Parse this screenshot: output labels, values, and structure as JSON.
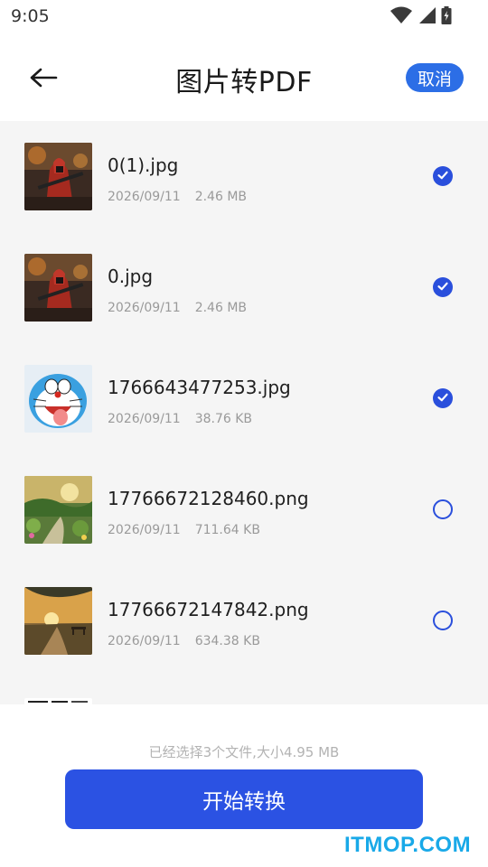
{
  "status_bar": {
    "time": "9:05",
    "icons": [
      "wifi-icon",
      "signal-icon",
      "battery-icon"
    ]
  },
  "header": {
    "title": "图片转PDF",
    "cancel_label": "取消",
    "back_icon": "arrow-left-icon"
  },
  "files": [
    {
      "name": "0(1).jpg",
      "date": "2026/09/11",
      "size": "2.46 MB",
      "selected": true,
      "thumb": "warrior-image-thumbnail"
    },
    {
      "name": "0.jpg",
      "date": "2026/09/11",
      "size": "2.46 MB",
      "selected": true,
      "thumb": "warrior-image-thumbnail"
    },
    {
      "name": "1766643477253.jpg",
      "date": "2026/09/11",
      "size": "38.76 KB",
      "selected": true,
      "thumb": "doraemon-image-thumbnail"
    },
    {
      "name": "17766672128460.png",
      "date": "2026/09/11",
      "size": "711.64 KB",
      "selected": false,
      "thumb": "garden-image-thumbnail"
    },
    {
      "name": "17766672147842.png",
      "date": "2026/09/11",
      "size": "634.38 KB",
      "selected": false,
      "thumb": "sunset-bench-image-thumbnail"
    }
  ],
  "footer": {
    "summary": "已经选择3个文件,大小4.95 MB",
    "start_label": "开始转换"
  },
  "watermark": "ITMOP.COM",
  "colors": {
    "accent": "#2b52e3",
    "cancel_bg": "#2c6ee6",
    "list_bg": "#f5f5f5",
    "watermark": "#19a9e8"
  }
}
